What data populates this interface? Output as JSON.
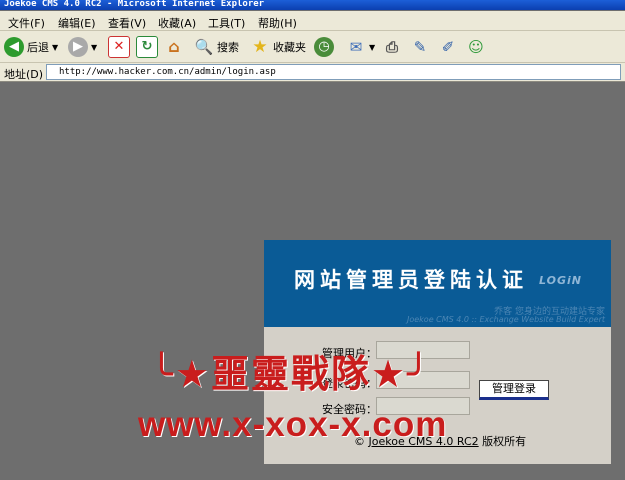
{
  "window": {
    "title": "Joekoe CMS 4.0 RC2 - Microsoft Internet Explorer"
  },
  "menu": [
    {
      "label": "文件(F)"
    },
    {
      "label": "编辑(E)"
    },
    {
      "label": "查看(V)"
    },
    {
      "label": "收藏(A)"
    },
    {
      "label": "工具(T)"
    },
    {
      "label": "帮助(H)"
    }
  ],
  "toolbar": {
    "back_label": "后退",
    "search_label": "搜索",
    "favorites_label": "收藏夹"
  },
  "address": {
    "label": "地址(D)",
    "url": "http://www.hacker.com.cn/admin/login.asp"
  },
  "login": {
    "title": "网站管理员登陆认证",
    "title_suffix": "LOGiN",
    "tagline": "乔客 您身边的互动建站专家",
    "tagline_en": "Joekoe CMS 4.0 :: Exchange Website Build Expert",
    "username_label": "管理用户：",
    "password_label": "登录密码：",
    "security_label": "安全密码：",
    "submit_label": "管理登录",
    "copyright_symbol": "©",
    "copyright_product": "Joekoe CMS 4.0 RC2",
    "copyright_rights": "版权所有"
  },
  "watermark": {
    "line1": "╰★噩靈戰隊★╯",
    "line2": "www.x-xox-x.com"
  },
  "colors": {
    "banner": "#0a5b96",
    "watermark": "#c91d1d",
    "background": "#6e6e6e"
  }
}
